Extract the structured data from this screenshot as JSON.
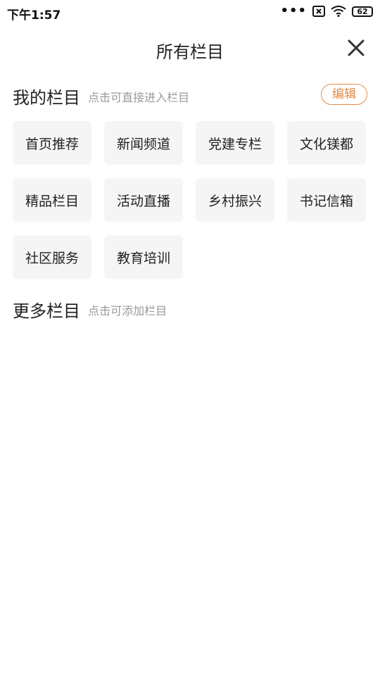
{
  "status": {
    "time": "下午1:57",
    "dots": "•••",
    "battery": "62"
  },
  "header": {
    "title": "所有栏目"
  },
  "my_section": {
    "title": "我的栏目",
    "hint": "点击可直接进入栏目",
    "edit_label": "编辑",
    "items": [
      "首页推荐",
      "新闻频道",
      "党建专栏",
      "文化镁都",
      "精品栏目",
      "活动直播",
      "乡村振兴",
      "书记信箱",
      "社区服务",
      "教育培训"
    ]
  },
  "more_section": {
    "title": "更多栏目",
    "hint": "点击可添加栏目"
  },
  "colors": {
    "accent": "#e38b45",
    "tile_bg": "#f5f5f5",
    "hint": "#999999"
  }
}
